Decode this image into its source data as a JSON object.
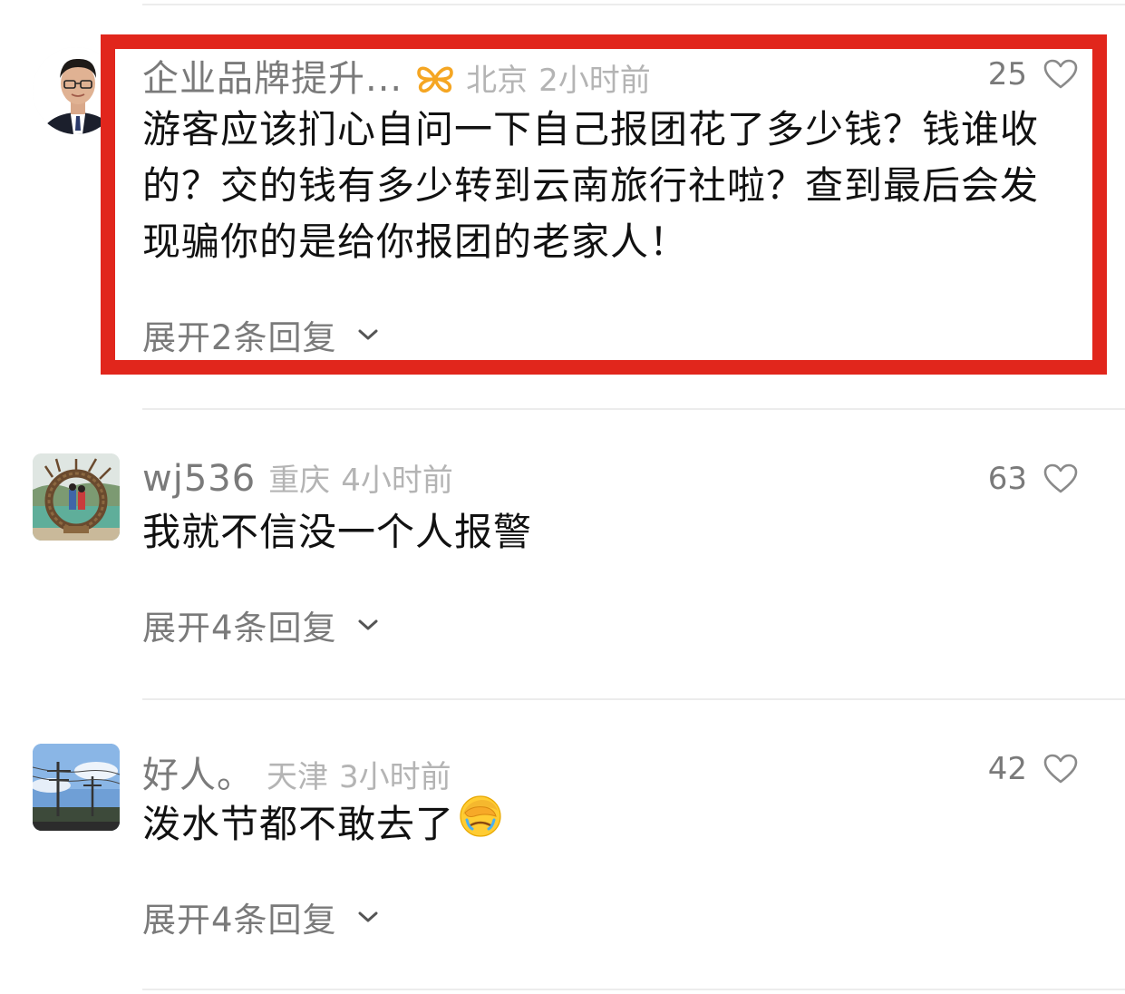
{
  "comments": [
    {
      "username": "企业品牌提升...",
      "location": "北京",
      "time": "2小时前",
      "likes": "25",
      "text": "游客应该扪心自问一下自己报团花了多少钱？钱谁收的？交的钱有多少转到云南旅行社啦？查到最后会发现骗你的是给你报团的老家人！",
      "replies": "展开2条回复",
      "badge_icon": "butterfly-badge-icon",
      "badge_color": "#f5a623"
    },
    {
      "username": "wj536",
      "location": "重庆",
      "time": "4小时前",
      "likes": "63",
      "text": "我就不信没一个人报警",
      "replies": "展开4条回复"
    },
    {
      "username": "好人。",
      "location": "天津",
      "time": "3小时前",
      "likes": "42",
      "text": "泼水节都不敢去了",
      "text_emoji": "facepalm-emoji",
      "replies": "展开4条回复"
    }
  ],
  "colors": {
    "highlight": "#e1261c",
    "username": "#7a7a7a",
    "meta": "#b4b4b4",
    "text": "#111111"
  }
}
